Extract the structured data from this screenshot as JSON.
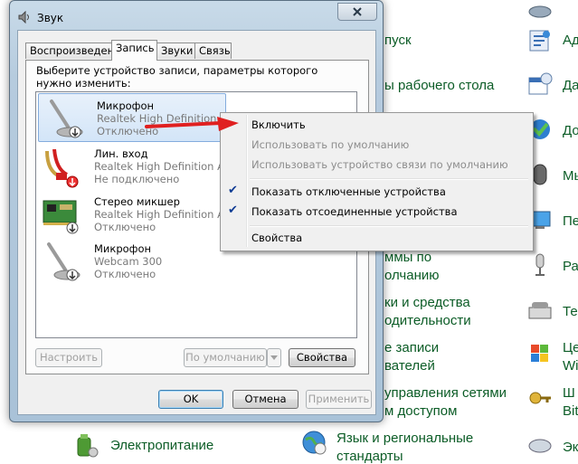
{
  "background": {
    "left_items": [
      {
        "label": "Электропитание"
      }
    ],
    "middle_items": [
      {
        "label": "пуск"
      },
      {
        "label": "ы рабочего стола"
      },
      {
        "label": "ммы по"
      },
      {
        "label": "олчанию"
      },
      {
        "label": "ки и средства"
      },
      {
        "label": "одительности"
      },
      {
        "label": "е записи"
      },
      {
        "label": "вателей"
      },
      {
        "label": "управления сетями"
      },
      {
        "label": "м доступом"
      },
      {
        "label": "Язык и региональные"
      },
      {
        "label": "стандарты"
      }
    ],
    "right_items": [
      {
        "label": "Ад"
      },
      {
        "label": "Да"
      },
      {
        "label": "До"
      },
      {
        "label": "Мь"
      },
      {
        "label": "Пе"
      },
      {
        "label": "Ра"
      },
      {
        "label": "Те"
      },
      {
        "label": "Це"
      },
      {
        "label": "Wi"
      },
      {
        "label": "Ш"
      },
      {
        "label": "Bit"
      },
      {
        "label": "Эк"
      }
    ]
  },
  "window": {
    "title": "Звук",
    "tabs": [
      {
        "label": "Воспроизведение",
        "active": false
      },
      {
        "label": "Запись",
        "active": true
      },
      {
        "label": "Звуки",
        "active": false
      },
      {
        "label": "Связь",
        "active": false
      }
    ],
    "instruction": "Выберите устройство записи, параметры которого нужно изменить:",
    "devices": [
      {
        "name": "Микрофон",
        "driver": "Realtek High Definition Au",
        "status": "Отключено",
        "selected": true
      },
      {
        "name": "Лин. вход",
        "driver": "Realtek High Definition Au",
        "status": "Не подключено",
        "selected": false
      },
      {
        "name": "Стерео микшер",
        "driver": "Realtek High Definition Au",
        "status": "Отключено",
        "selected": false
      },
      {
        "name": "Микрофон",
        "driver": "Webcam 300",
        "status": "Отключено",
        "selected": false
      }
    ],
    "buttons": {
      "configure": "Настроить",
      "set_default": "По умолчанию",
      "properties": "Свойства",
      "ok": "OK",
      "cancel": "Отмена",
      "apply": "Применить"
    }
  },
  "context_menu": {
    "enable": "Включить",
    "use_default": "Использовать по умолчанию",
    "use_default_comm": "Использовать устройство связи по умолчанию",
    "show_disabled": "Показать отключенные устройства",
    "show_disconnected": "Показать отсоединенные устройства",
    "properties": "Свойства",
    "show_disabled_checked": true,
    "show_disconnected_checked": true
  },
  "colors": {
    "link_green": "#0b5c26",
    "annotation_arrow": "#e02020",
    "selection": "#d3e5f8",
    "check": "#0f3c94"
  }
}
